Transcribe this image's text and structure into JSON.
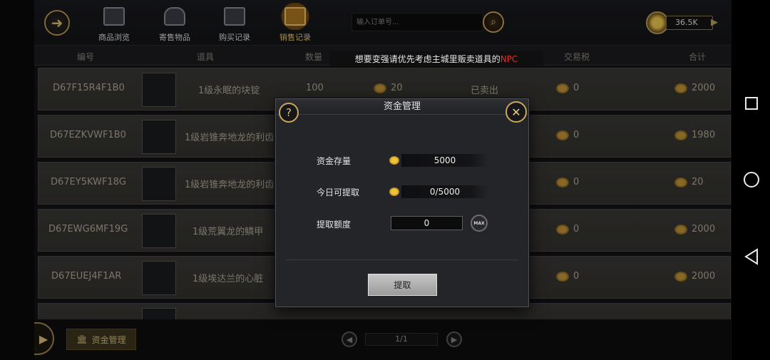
{
  "topbar": {
    "tabs": [
      {
        "label": "商品浏览",
        "icon": "browse-icon"
      },
      {
        "label": "寄售物品",
        "icon": "consign-bag-icon"
      },
      {
        "label": "购买记录",
        "icon": "purchase-record-icon"
      },
      {
        "label": "销售记录",
        "icon": "sales-record-icon",
        "active": true
      }
    ],
    "search_placeholder": "输入订单号...",
    "currency_amount": "36.5K",
    "help": "?"
  },
  "table": {
    "headers": [
      "编号",
      "道具",
      "数量",
      "交易税",
      "合计"
    ],
    "rows": [
      {
        "id": "D67F15R4F1B0",
        "item": "1级永眠的块锭",
        "qty": "100",
        "price": "20",
        "status": "已卖出",
        "tax": "0",
        "total": "2000"
      },
      {
        "id": "D67EZKVWF1B0",
        "item": "1级岩锥奔地龙的利齿",
        "qty": "",
        "price": "",
        "status": "",
        "tax": "0",
        "total": "1980"
      },
      {
        "id": "D67EY5KWF18G",
        "item": "1级岩锥奔地龙的利齿",
        "qty": "",
        "price": "",
        "status": "",
        "tax": "0",
        "total": "20"
      },
      {
        "id": "D67EWG6MF19G",
        "item": "1级荒翼龙的鳞甲",
        "qty": "",
        "price": "",
        "status": "",
        "tax": "0",
        "total": "2000"
      },
      {
        "id": "D67EUEJ4F1AR",
        "item": "1级埃达兰的心脏",
        "qty": "",
        "price": "",
        "status": "",
        "tax": "0",
        "total": "2000"
      }
    ]
  },
  "notice": {
    "text": "想要变强请优先考虑主城里贩卖道具的",
    "highlight": "NPC"
  },
  "bottom": {
    "fund_button": "资金管理",
    "page": "1/1"
  },
  "modal": {
    "title": "资金管理",
    "help": "?",
    "close": "✕",
    "stock_label": "资金存量",
    "stock_value": "5000",
    "today_label": "今日可提取",
    "today_value": "0/5000",
    "limit_label": "提取额度",
    "limit_value": "0",
    "max_label": "MAX",
    "withdraw_label": "提取"
  }
}
